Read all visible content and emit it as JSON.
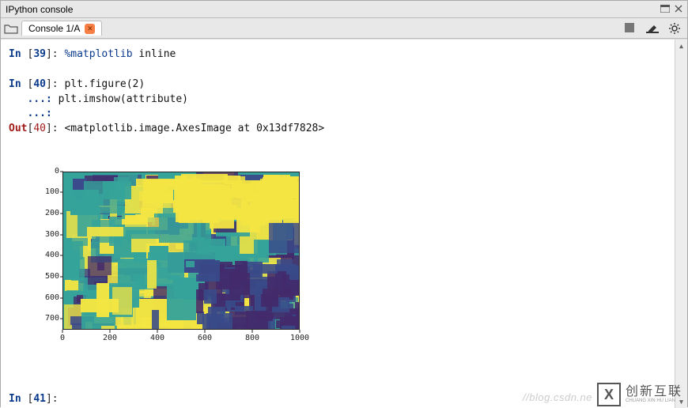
{
  "window": {
    "title": "IPython console"
  },
  "tabs": {
    "active_label": "Console 1/A"
  },
  "console": {
    "cells": [
      {
        "type": "in",
        "n": "39",
        "code": "%matplotlib inline"
      },
      {
        "type": "in",
        "n": "40",
        "code": "plt.figure(2)"
      },
      {
        "type": "cont",
        "code": "plt.imshow(attribute)"
      },
      {
        "type": "cont",
        "code": ""
      },
      {
        "type": "out",
        "n": "40",
        "code": "<matplotlib.image.AxesImage at 0x13df7828>"
      },
      {
        "type": "in",
        "n": "41",
        "code": ""
      }
    ],
    "prompt_labels": {
      "in": "In",
      "out": "Out",
      "cont": "...:"
    }
  },
  "chart_data": {
    "type": "heatmap",
    "title": "",
    "xlabel": "",
    "ylabel": "",
    "x_range": [
      0,
      1000
    ],
    "y_range": [
      0,
      750
    ],
    "y_inverted": true,
    "x_ticks": [
      0,
      200,
      400,
      600,
      800,
      1000
    ],
    "y_ticks": [
      0,
      100,
      200,
      300,
      400,
      500,
      600,
      700
    ],
    "colormap": "viridis",
    "description": "2D categorical/attribute raster (~1000×750) rendered with imshow; pixel values not individually legible.",
    "value_range_estimate": [
      0,
      1
    ],
    "dominant_colors": [
      "#f4e542",
      "#35a39a",
      "#3a4a8a",
      "#432a6b"
    ]
  },
  "watermark": "//blog.csdn.ne",
  "brand": {
    "mark": "X",
    "name": "创新互联",
    "sub": "CHUANG XIN HU LIAN"
  }
}
